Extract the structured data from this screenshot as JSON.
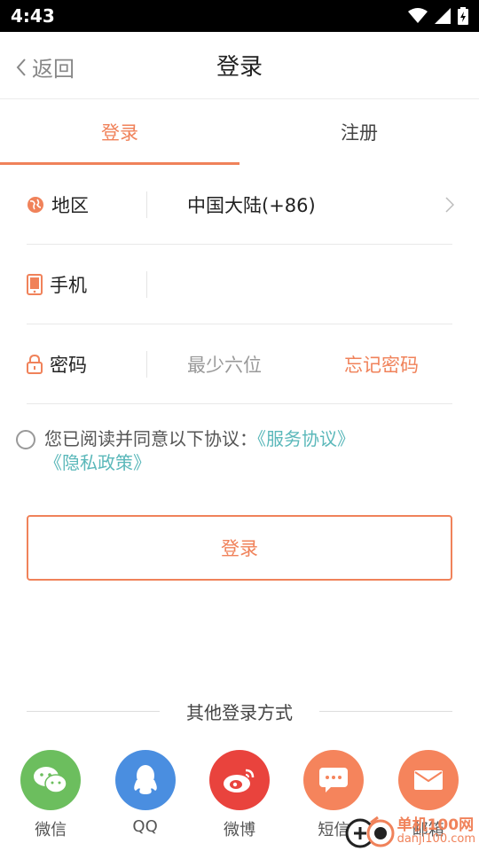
{
  "status": {
    "time": "4:43"
  },
  "nav": {
    "back_label": "返回",
    "title": "登录"
  },
  "tabs": [
    {
      "label": "登录",
      "active": true
    },
    {
      "label": "注册",
      "active": false
    }
  ],
  "form": {
    "region": {
      "label": "地区",
      "value": "中国大陆(+86)"
    },
    "phone": {
      "label": "手机",
      "value": ""
    },
    "password": {
      "label": "密码",
      "placeholder": "最少六位",
      "forgot": "忘记密码"
    }
  },
  "agreement": {
    "text": "您已阅读并同意以下协议：",
    "service_link": "《服务协议》",
    "privacy_link": "《隐私政策》"
  },
  "login_button": "登录",
  "other_login": {
    "title": "其他登录方式",
    "items": [
      {
        "label": "微信",
        "icon": "wechat-icon",
        "color": "#6cbe5e"
      },
      {
        "label": "QQ",
        "icon": "qq-icon",
        "color": "#4a8ee0"
      },
      {
        "label": "微博",
        "icon": "weibo-icon",
        "color": "#e9433d"
      },
      {
        "label": "短信",
        "icon": "sms-icon",
        "color": "#f5845c"
      },
      {
        "label": "邮箱",
        "icon": "mail-icon",
        "color": "#f5845c"
      }
    ]
  },
  "watermark": {
    "main": "单机100网",
    "sub": "danji100.com"
  },
  "colors": {
    "accent": "#f0825a",
    "link": "#5bb8ba"
  }
}
